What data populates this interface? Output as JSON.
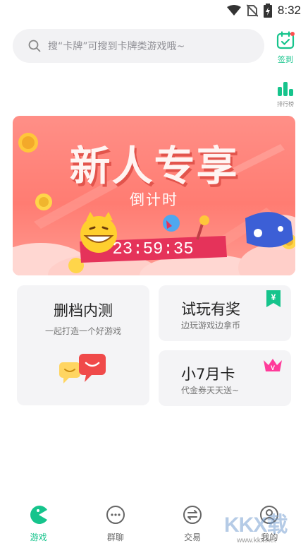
{
  "status_bar": {
    "time": "8:32"
  },
  "search": {
    "placeholder": "搜“卡牌”可搜到卡牌类游戏哦~"
  },
  "side_buttons": {
    "checkin_label": "签到",
    "ranking_label": "排行榜"
  },
  "banner": {
    "title": "新人专享",
    "subtitle": "倒计时",
    "countdown": "23:59:35"
  },
  "cards": [
    {
      "title": "删档内测",
      "subtitle": "一起打造一个好游戏"
    },
    {
      "title": "试玩有奖",
      "subtitle": "边玩游戏边拿币"
    },
    {
      "title": "小7月卡",
      "subtitle": "代金券天天送~"
    }
  ],
  "nav": [
    {
      "label": "游戏",
      "active": true
    },
    {
      "label": "群聊",
      "active": false
    },
    {
      "label": "交易",
      "active": false
    },
    {
      "label": "我的",
      "active": false
    }
  ],
  "watermark": {
    "text": "KKX载",
    "url": "www.kkx.net"
  },
  "colors": {
    "accent": "#16c48c",
    "banner": "#ff7c72",
    "card_bg": "#f4f4f6"
  }
}
